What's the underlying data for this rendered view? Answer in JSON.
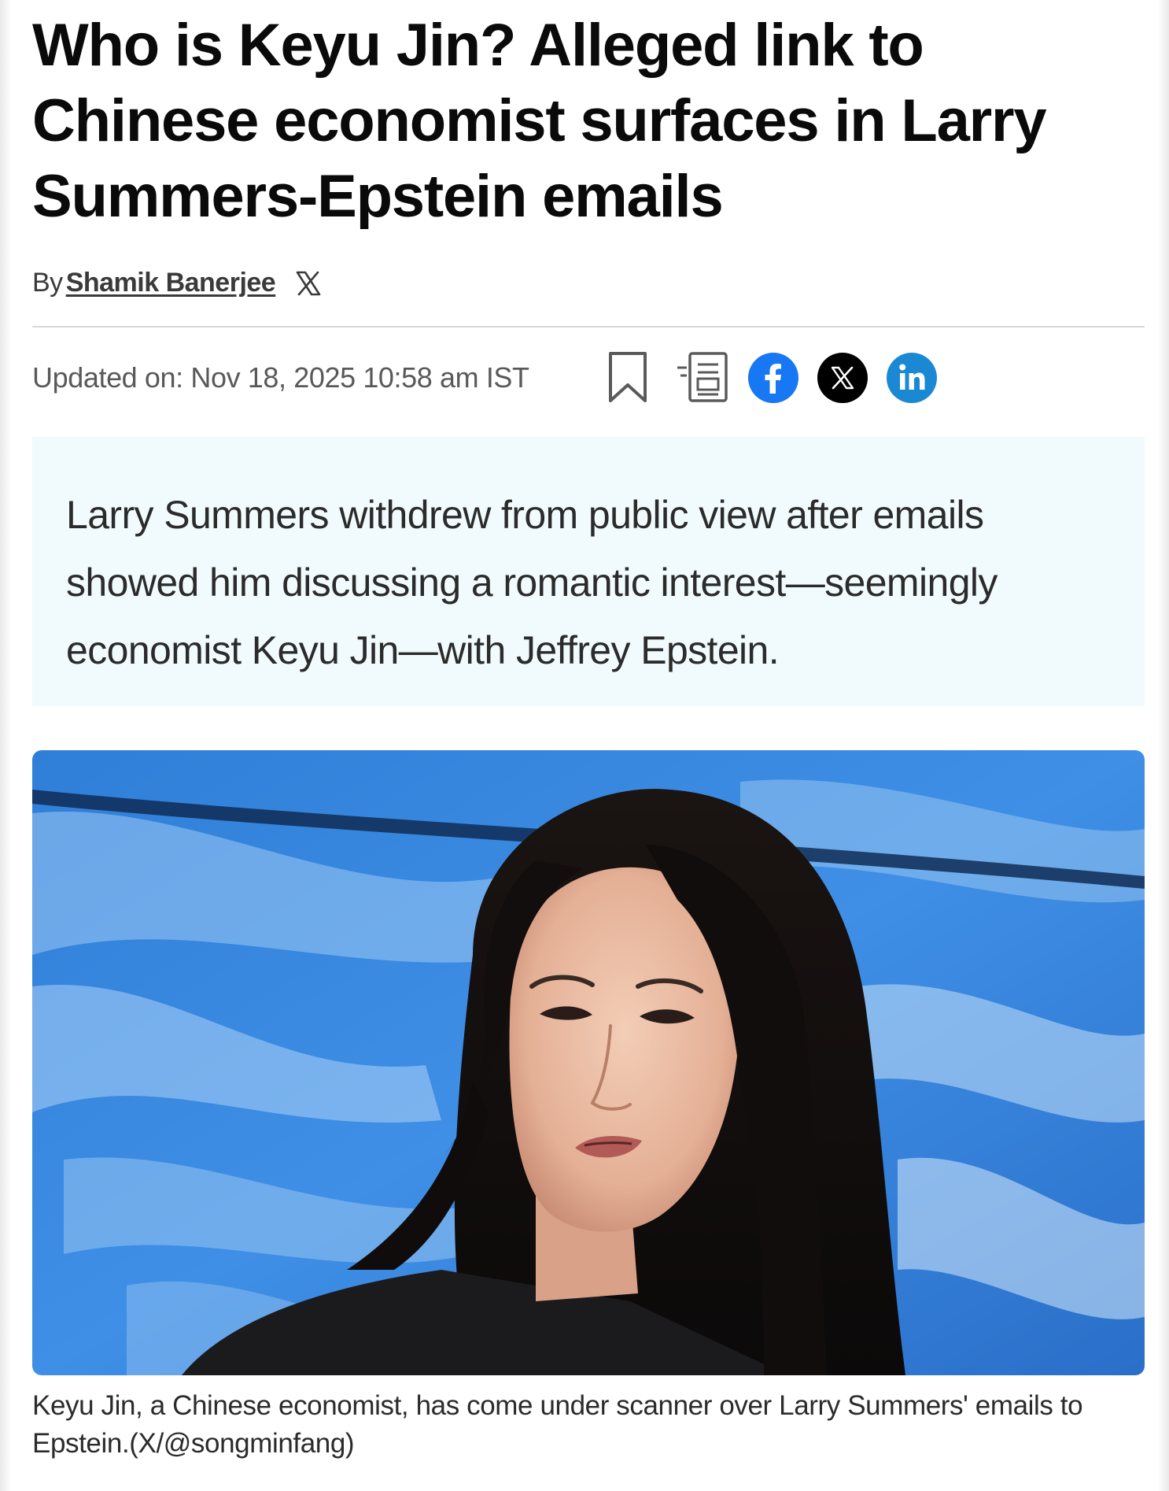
{
  "article": {
    "headline": "Who is Keyu Jin? Alleged link to Chinese economist surfaces in Larry Summers-Epstein emails",
    "byline_prefix": "By",
    "author_name": "Shamik Banerjee",
    "updated": "Updated on: Nov 18, 2025 10:58 am IST",
    "summary": "Larry Summers withdrew from public view after emails showed him discussing a romantic interest—seemingly economist Keyu Jin—with Jeffrey Epstein.",
    "hero_image_alt": "Keyu Jin",
    "caption": "Keyu Jin, a Chinese economist, has come under scanner over Larry Summers' emails to Epstein.(X/@songminfang)"
  },
  "icons": {
    "author_social": "x-logo-icon",
    "tools": [
      "bookmark-icon",
      "read-mode-icon",
      "facebook-icon",
      "x-icon",
      "linkedin-icon"
    ]
  },
  "colors": {
    "summary_background": "#f1fbfd",
    "facebook": "#1877f2",
    "x": "#000000",
    "linkedin": "#1b88d3",
    "divider": "#d8d8d8"
  }
}
